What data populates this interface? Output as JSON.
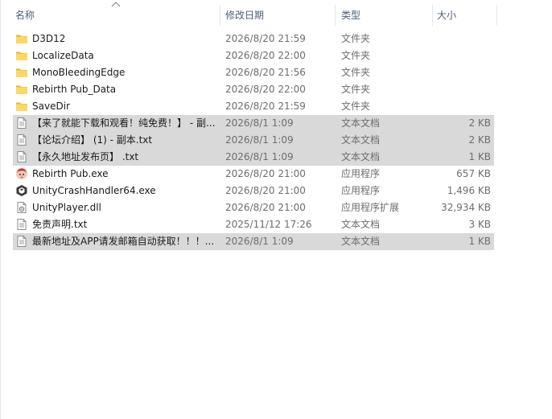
{
  "columns": {
    "name": "名称",
    "date": "修改日期",
    "type": "类型",
    "size": "大小"
  },
  "files": [
    {
      "name": "D3D12",
      "date": "2026/8/20 21:59",
      "type": "文件夹",
      "size": "",
      "icon": "folder-icon",
      "selected": false
    },
    {
      "name": "LocalizeData",
      "date": "2026/8/20 22:00",
      "type": "文件夹",
      "size": "",
      "icon": "folder-icon",
      "selected": false
    },
    {
      "name": "MonoBleedingEdge",
      "date": "2026/8/20 21:56",
      "type": "文件夹",
      "size": "",
      "icon": "folder-icon",
      "selected": false
    },
    {
      "name": "Rebirth Pub_Data",
      "date": "2026/8/20 22:00",
      "type": "文件夹",
      "size": "",
      "icon": "folder-icon",
      "selected": false
    },
    {
      "name": "SaveDir",
      "date": "2026/8/20 21:59",
      "type": "文件夹",
      "size": "",
      "icon": "folder-icon",
      "selected": false
    },
    {
      "name": "【来了就能下载和观看！纯免费！】 - 副...",
      "date": "2026/8/1 1:09",
      "type": "文本文档",
      "size": "2 KB",
      "icon": "text-file-icon",
      "selected": true
    },
    {
      "name": "【论坛介绍】 (1) - 副本.txt",
      "date": "2026/8/1 1:09",
      "type": "文本文档",
      "size": "2 KB",
      "icon": "text-file-icon",
      "selected": true
    },
    {
      "name": "【永久地址发布页】 .txt",
      "date": "2026/8/1 1:09",
      "type": "文本文档",
      "size": "1 KB",
      "icon": "text-file-icon",
      "selected": true
    },
    {
      "name": "Rebirth Pub.exe",
      "date": "2026/8/20 21:00",
      "type": "应用程序",
      "size": "657 KB",
      "icon": "game-app-icon",
      "selected": false
    },
    {
      "name": "UnityCrashHandler64.exe",
      "date": "2026/8/20 21:00",
      "type": "应用程序",
      "size": "1,496 KB",
      "icon": "unity-app-icon",
      "selected": false
    },
    {
      "name": "UnityPlayer.dll",
      "date": "2026/8/20 21:00",
      "type": "应用程序扩展",
      "size": "32,934 KB",
      "icon": "dll-file-icon",
      "selected": false
    },
    {
      "name": "免责声明.txt",
      "date": "2025/11/12 17:26",
      "type": "文本文档",
      "size": "3 KB",
      "icon": "text-file-icon",
      "selected": false
    },
    {
      "name": "最新地址及APP请发邮箱自动获取！！！...",
      "date": "2026/8/1 1:09",
      "type": "文本文档",
      "size": "1 KB",
      "icon": "text-file-icon",
      "selected": true
    }
  ]
}
